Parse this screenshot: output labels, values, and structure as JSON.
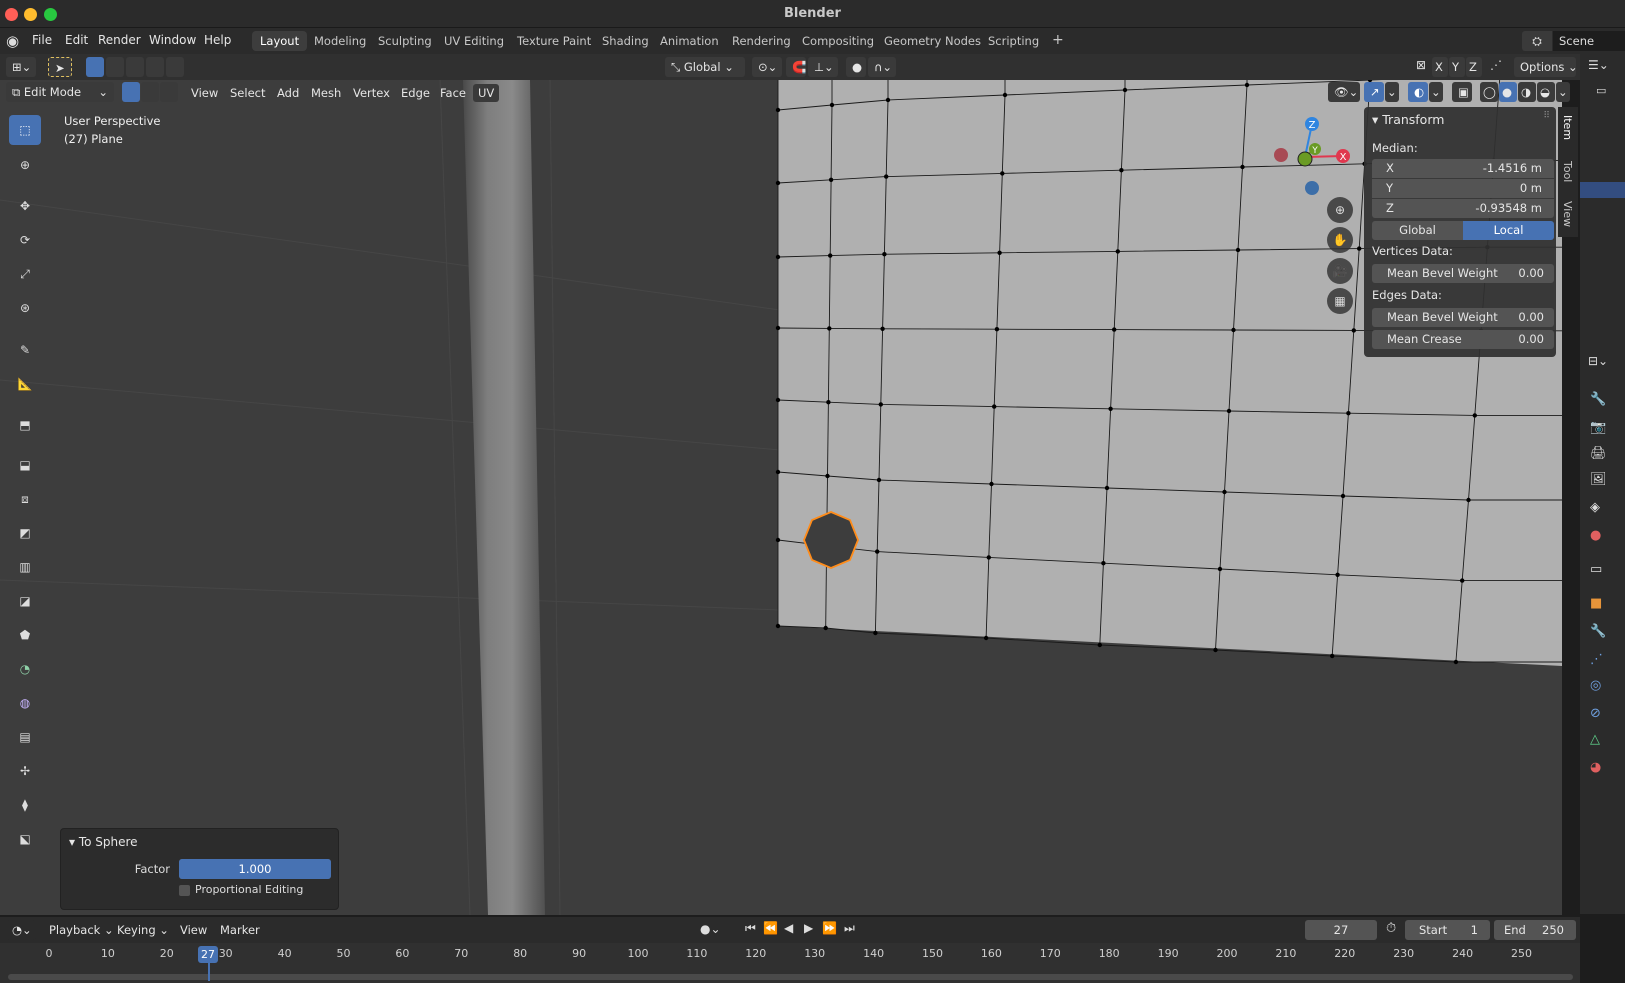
{
  "window": {
    "title": "Blender"
  },
  "menubar": {
    "items": [
      "File",
      "Edit",
      "Render",
      "Window",
      "Help"
    ],
    "workspaces": [
      "Layout",
      "Modeling",
      "Sculpting",
      "UV Editing",
      "Texture Paint",
      "Shading",
      "Animation",
      "Rendering",
      "Compositing",
      "Geometry Nodes",
      "Scripting"
    ],
    "active_workspace": "Layout",
    "add_tab": "+",
    "scene": "Scene"
  },
  "tool_header": {
    "orientation": "Global",
    "axes": [
      "X",
      "Y",
      "Z"
    ],
    "options": "Options"
  },
  "viewport_header": {
    "mode": "Edit Mode",
    "menus": [
      "View",
      "Select",
      "Add",
      "Mesh",
      "Vertex",
      "Edge",
      "Face",
      "UV"
    ]
  },
  "viewport": {
    "perspective": "User Perspective",
    "object": "(27) Plane",
    "gizmo": {
      "z": "Z",
      "y": "Y",
      "x": "X"
    }
  },
  "npanel": {
    "section": "Transform",
    "median_label": "Median:",
    "fields": [
      {
        "axis": "X",
        "value": "-1.4516 m"
      },
      {
        "axis": "Y",
        "value": "0 m"
      },
      {
        "axis": "Z",
        "value": "-0.93548 m"
      }
    ],
    "toggle": {
      "global": "Global",
      "local": "Local",
      "active": "Local"
    },
    "vertices_label": "Vertices Data:",
    "vertices_fields": [
      {
        "label": "Mean Bevel Weight",
        "value": "0.00"
      }
    ],
    "edges_label": "Edges Data:",
    "edges_fields": [
      {
        "label": "Mean Bevel Weight",
        "value": "0.00"
      },
      {
        "label": "Mean Crease",
        "value": "0.00"
      }
    ],
    "tabs": [
      "Item",
      "Tool",
      "View"
    ]
  },
  "operator_panel": {
    "title": "To Sphere",
    "factor_label": "Factor",
    "factor_value": "1.000",
    "factor": 1.0,
    "proportional_label": "Proportional Editing",
    "proportional_checked": false
  },
  "timeline": {
    "menus": [
      "Playback",
      "Keying",
      "View",
      "Marker"
    ],
    "current_frame": "27",
    "start_label": "Start",
    "start": "1",
    "end_label": "End",
    "end": "250",
    "ticks": [
      "0",
      "10",
      "20",
      "30",
      "40",
      "50",
      "60",
      "70",
      "80",
      "90",
      "100",
      "110",
      "120",
      "130",
      "140",
      "150",
      "160",
      "170",
      "180",
      "190",
      "200",
      "210",
      "220",
      "230",
      "240",
      "250"
    ],
    "playhead": "27"
  },
  "colors": {
    "accent": "#4772b3",
    "selected_edge": "#ff8c1a",
    "axis_x": "#e0384f",
    "axis_y": "#6a9b24",
    "axis_z": "#2f85e0"
  }
}
